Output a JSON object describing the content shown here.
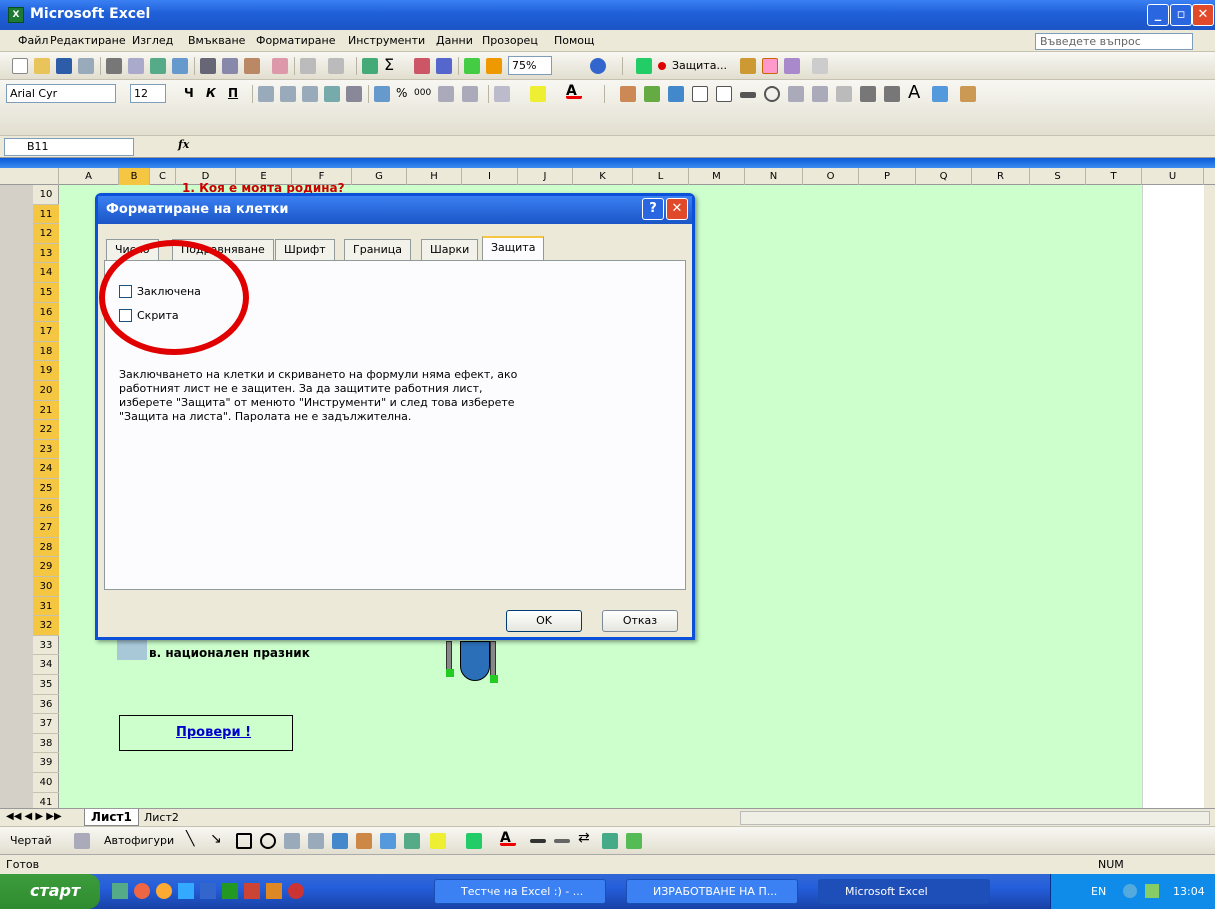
{
  "window": {
    "title": "Microsoft Excel",
    "app_icon": "excel-icon"
  },
  "menu": {
    "items": [
      "Файл",
      "Редактиране",
      "Изглед",
      "Вмъкване",
      "Форматиране",
      "Инструменти",
      "Данни",
      "Прозорец",
      "Помощ"
    ],
    "help_placeholder": "Въведете въпрос"
  },
  "toolbar": {
    "zoom": "75%",
    "protection_label": "Защита..."
  },
  "format": {
    "font_name": "Arial Cyr",
    "font_size": "12"
  },
  "formula": {
    "cell_ref": "B11",
    "fx": "fx"
  },
  "sheet": {
    "columns": [
      "A",
      "B",
      "C",
      "D",
      "E",
      "F",
      "G",
      "H",
      "I",
      "J",
      "K",
      "L",
      "M",
      "N",
      "O",
      "P",
      "Q",
      "R",
      "S",
      "T",
      "U"
    ],
    "rows": [
      "10",
      "11",
      "12",
      "13",
      "14",
      "15",
      "16",
      "17",
      "18",
      "19",
      "20",
      "21",
      "22",
      "23",
      "24",
      "25",
      "26",
      "27",
      "28",
      "29",
      "30",
      "31",
      "32",
      "33",
      "34",
      "35",
      "36",
      "37",
      "38",
      "39",
      "40",
      "41"
    ],
    "question_title": "1. Коя е моята родина?",
    "answer_c": "в.  национален празник",
    "check_button": "Провери !",
    "tabs": [
      "Лист1",
      "Лист2"
    ]
  },
  "dialog": {
    "title": "Форматиране на клетки",
    "tabs": [
      "Число",
      "Подравняване",
      "Шрифт",
      "Граница",
      "Шарки",
      "Защита"
    ],
    "active_tab": "Защита",
    "locked_label": "Заключена",
    "hidden_label": "Скрита",
    "description": "Заключването на клетки и скриването на формули няма ефект, ако работният лист не е защитен. За да защитите работния лист, изберете \"Защита\" от менюто \"Инструменти\" и след това изберете \"Защита на листа\". Паролата не е задължителна.",
    "ok": "OK",
    "cancel": "Отказ"
  },
  "drawing": {
    "draw_label": "Чертай",
    "autoshapes_label": "Автофигури"
  },
  "status": {
    "ready": "Готов",
    "num": "NUM"
  },
  "taskbar": {
    "start": "старт",
    "tasks": [
      "Тестче на Excel :) - ...",
      "ИЗРАБОТВАНЕ НА П...",
      "Microsoft Excel"
    ],
    "lang": "EN",
    "clock": "13:04"
  }
}
